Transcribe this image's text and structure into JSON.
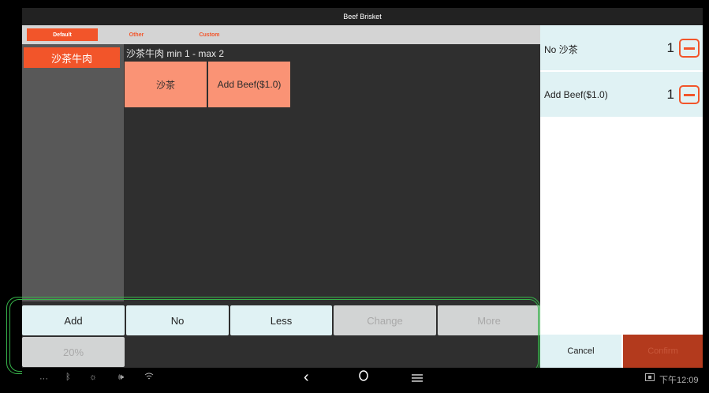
{
  "window": {
    "title": "Beef Brisket"
  },
  "tabs": [
    {
      "label": "Default",
      "active": true
    },
    {
      "label": "Other",
      "active": false
    },
    {
      "label": "Custom",
      "active": false
    }
  ],
  "categories": [
    {
      "label": "沙茶牛肉"
    }
  ],
  "option_group": {
    "label": "沙茶牛肉 min 1 - max 2",
    "options": [
      {
        "label": "沙茶"
      },
      {
        "label": "Add Beef($1.0)"
      }
    ]
  },
  "selected": [
    {
      "name": "No 沙茶",
      "qty": "1"
    },
    {
      "name": "Add Beef($1.0)",
      "qty": "1"
    }
  ],
  "modifiers": [
    {
      "label": "Add",
      "enabled": true
    },
    {
      "label": "No",
      "enabled": true
    },
    {
      "label": "Less",
      "enabled": true
    },
    {
      "label": "Change",
      "enabled": false
    },
    {
      "label": "More",
      "enabled": false
    },
    {
      "label": "20%",
      "enabled": false
    }
  ],
  "footer": {
    "cancel_label": "Cancel",
    "confirm_label": "Confirm"
  },
  "system_bar": {
    "icons": [
      "more-dots-icon",
      "bluetooth-off-icon",
      "brightness-icon",
      "volume-icon",
      "wifi-icon",
      "back-icon",
      "home-icon",
      "recents-icon",
      "screenshot-icon"
    ],
    "time": "下午12:09"
  },
  "colors": {
    "accent": "#f2552a",
    "option_bg": "#fa9375",
    "panel_light": "#e0f2f4",
    "highlight_outline": "#37b34a"
  }
}
